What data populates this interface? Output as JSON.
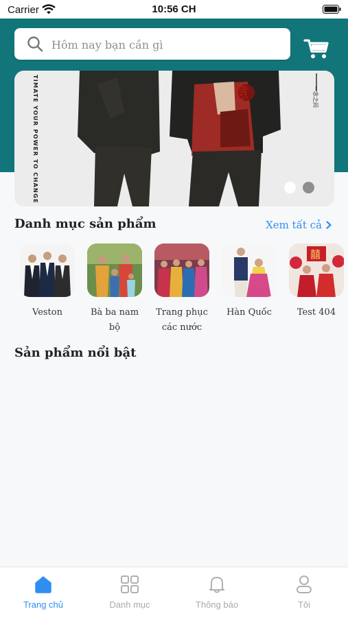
{
  "status_bar": {
    "carrier": "Carrier",
    "time": "10:56 CH"
  },
  "search": {
    "placeholder": "Hôm nay bạn cần gì"
  },
  "banner": {
    "vertical_text": "TIMATE YOUR POWER TO CHANGE YOURSELF",
    "slides": 2,
    "active_slide": 1
  },
  "categories_section": {
    "title": "Danh mục sản phẩm",
    "see_all": "Xem tất cả",
    "items": [
      {
        "label": "Veston"
      },
      {
        "label": "Bà ba nam bộ"
      },
      {
        "label": "Trang phục các nước"
      },
      {
        "label": "Hàn Quốc"
      },
      {
        "label": "Test 404"
      }
    ]
  },
  "featured_section": {
    "title": "Sản phẩm nổi bật"
  },
  "tabbar": {
    "items": [
      {
        "label": "Trang chủ",
        "icon": "home-icon",
        "active": true
      },
      {
        "label": "Danh mục",
        "icon": "grid-icon",
        "active": false
      },
      {
        "label": "Thông báo",
        "icon": "bell-icon",
        "active": false
      },
      {
        "label": "Tôi",
        "icon": "user-icon",
        "active": false
      }
    ]
  },
  "colors": {
    "header": "#127579",
    "accent": "#2e8ff0",
    "inactive": "#a9a9a9"
  }
}
